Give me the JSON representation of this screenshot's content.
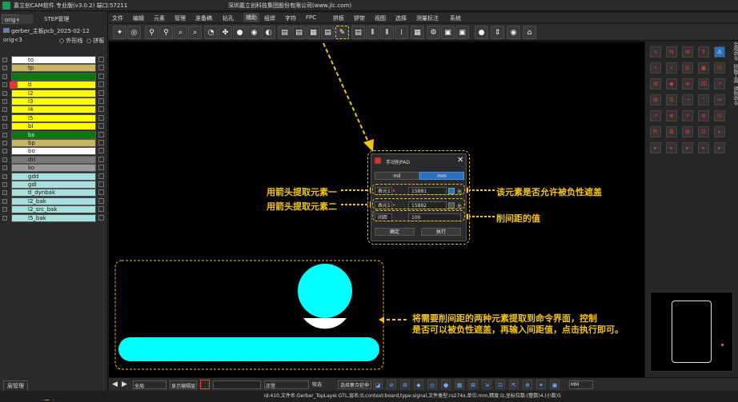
{
  "titlebar": {
    "app_title": "嘉立创CAM软件 专业版(v3.0.2) 端口:57211",
    "company": "深圳嘉立创科技集团股份有限公司(www.jlc.com)"
  },
  "menu": [
    "文件",
    "编辑",
    "元素",
    "管理",
    "准备稿",
    "钻孔",
    "辅助",
    "组焊",
    "字符",
    "FPC",
    "拼板",
    "锣带",
    "视图",
    "选择",
    "测量标注",
    "系统"
  ],
  "active_menu": "辅助",
  "left": {
    "tab1": "orig+",
    "tab2": "STEP管理",
    "job": "gerber_主板pcb_2025-02-12",
    "step": "orig<3",
    "opt1": "外形线",
    "opt2": "拼板",
    "layers": [
      {
        "name": "to",
        "color": "#ffffff"
      },
      {
        "name": "tp",
        "color": "#c8b560"
      },
      {
        "name": "",
        "color": "#0a7a0a"
      },
      {
        "name": "tl",
        "color": "#ffff00"
      },
      {
        "name": "l2",
        "color": "#ffff00"
      },
      {
        "name": "l3",
        "color": "#ffff00"
      },
      {
        "name": "l4",
        "color": "#ffff00"
      },
      {
        "name": "l5",
        "color": "#ffff00"
      },
      {
        "name": "bl",
        "color": "#ffff00"
      },
      {
        "name": "bs",
        "color": "#0a7a0a"
      },
      {
        "name": "bp",
        "color": "#c8b560"
      },
      {
        "name": "bo",
        "color": "#ffffff"
      },
      {
        "name": "drl",
        "color": "#7a7a7a"
      },
      {
        "name": "ko",
        "color": "#9a9a9a"
      },
      {
        "name": "gdd",
        "color": "#a8e0e0"
      },
      {
        "name": "gdl",
        "color": "#a8e0e0"
      },
      {
        "name": "tl_dynbak",
        "color": "#a8e0e0"
      },
      {
        "name": "l2_bak",
        "color": "#a8e0e0"
      },
      {
        "name": "l2_src_bak",
        "color": "#a8e0e0"
      },
      {
        "name": "l5_bak",
        "color": "#a8e0e0"
      }
    ],
    "layer_mgr": "层管理",
    "selected": "选中:2"
  },
  "dialog": {
    "title": "手动削PAD",
    "tab_mil": "mil",
    "tab_mm": "mm",
    "row1_label": "表元1",
    "row1_val": "15881",
    "row1_check": "允",
    "row2_label": "表元1",
    "row2_val": "15882",
    "row2_check": "允",
    "row3_label": "间距",
    "row3_val": "100",
    "ok": "确定",
    "exec": "执行"
  },
  "annotations": {
    "a1": "用箭头提取元素一",
    "a2": "用箭头提取元素二",
    "a3": "该元素是否允许被负性遮盖",
    "a4": "削间距的值",
    "a5": "将需要削间距的两种元素提取到命令界面，控制",
    "a6": "是否可以被负性遮盖，再输入间距值，点击执行即可。"
  },
  "bottom": {
    "fit": "全局",
    "display": "显示编辑层",
    "mode": "正常",
    "sel": "吸选",
    "sel2": "选择集合延伸",
    "unit": "MM"
  },
  "status": "id:410,文件名:Gerber_TopLayer.GTL,层名:tl,context:board,type:signal,文件类型:rs274x,单位:mm,精度:lz,坐标位数:(整数)4.(小数)5",
  "right_tabs": [
    "全局命令",
    "拼板工具",
    "锣附命令"
  ],
  "colors": {
    "accent": "#f1c40f",
    "shape": "#00ffff",
    "canvas": "#000000"
  }
}
